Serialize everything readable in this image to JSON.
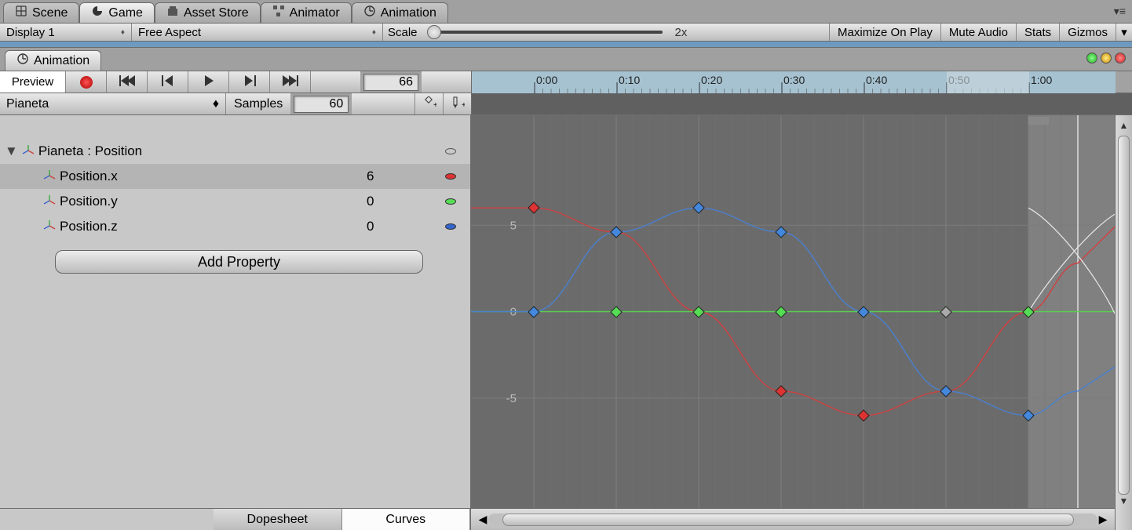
{
  "top_tabs": {
    "scene": "Scene",
    "game": "Game",
    "asset_store": "Asset Store",
    "animator": "Animator",
    "animation": "Animation"
  },
  "game_toolbar": {
    "display": "Display 1",
    "aspect": "Free Aspect",
    "scale_label": "Scale",
    "scale_value": "2x",
    "maximize": "Maximize On Play",
    "mute": "Mute Audio",
    "stats": "Stats",
    "gizmos": "Gizmos"
  },
  "sub_tab": "Animation",
  "controls": {
    "preview": "Preview",
    "frame_value": "66"
  },
  "clip": {
    "name": "Pianeta",
    "samples_label": "Samples",
    "samples_value": "60"
  },
  "properties": {
    "group": "Pianeta : Position",
    "items": [
      {
        "name": "Position.x",
        "value": "6",
        "color": "red"
      },
      {
        "name": "Position.y",
        "value": "0",
        "color": "green"
      },
      {
        "name": "Position.z",
        "value": "0",
        "color": "blue"
      }
    ],
    "add_button": "Add Property"
  },
  "bottom_tabs": {
    "dopesheet": "Dopesheet",
    "curves": "Curves"
  },
  "timeline_ticks": [
    "0:00",
    "0:10",
    "0:20",
    "0:30",
    "0:40",
    "0:50",
    "1:00"
  ],
  "chart_data": {
    "type": "line",
    "xlabel": "",
    "ylabel": "",
    "ylim": [
      -10,
      10
    ],
    "y_ticks": [
      5,
      0,
      -5
    ],
    "x": [
      0,
      10,
      20,
      30,
      40,
      50,
      60,
      66
    ],
    "series": [
      {
        "name": "Position.x",
        "color": "#d04040",
        "values": [
          6,
          4.6,
          0,
          -4.6,
          -6,
          -4.6,
          0,
          2.8
        ]
      },
      {
        "name": "Position.y",
        "color": "#5ad050",
        "values": [
          0,
          0,
          0,
          0,
          0,
          0,
          0,
          0
        ]
      },
      {
        "name": "Position.z",
        "color": "#4a80d0",
        "values": [
          0,
          4.6,
          6,
          4.6,
          0,
          -4.6,
          -6,
          -4.6
        ]
      }
    ],
    "keyframe_x": [
      0,
      10,
      20,
      30,
      40,
      50,
      60
    ]
  }
}
